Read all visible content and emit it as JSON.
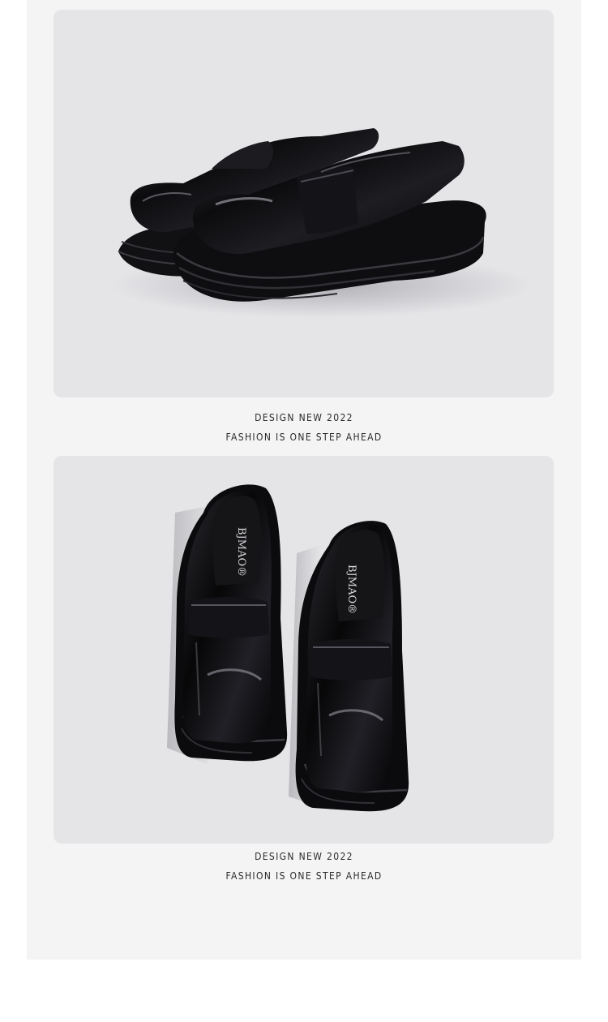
{
  "product_images": [
    {
      "description_icon": "black-patent-loafers-side-view-icon",
      "caption_line1": "DESIGN NEW 2022",
      "caption_line2": "FASHION IS ONE STEP AHEAD"
    },
    {
      "description_icon": "black-patent-loafers-top-view-icon",
      "brand_mark": "BJMAO",
      "caption_line1": "DESIGN NEW 2022",
      "caption_line2": "FASHION IS ONE STEP AHEAD"
    }
  ],
  "colors": {
    "page_bg": "#ffffff",
    "panel_bg": "#f4f4f4",
    "photo_bg": "#e5e5e8",
    "shoe": "#0d0d0f",
    "text": "#2b2b2b"
  }
}
